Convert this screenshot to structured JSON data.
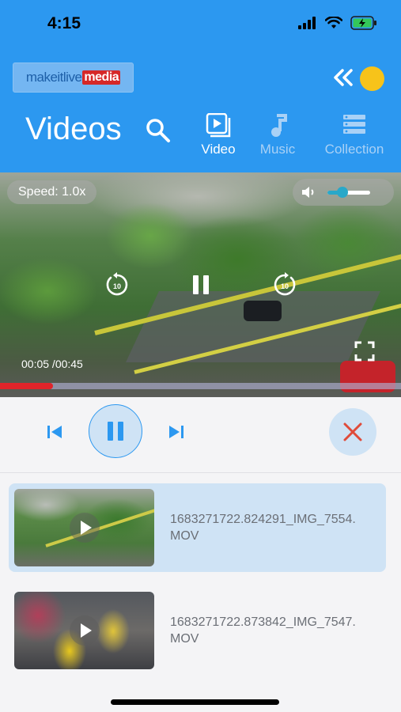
{
  "status_bar": {
    "time": "4:15"
  },
  "header": {
    "logo": {
      "part1": "makeitlive",
      "part2": "media"
    },
    "title": "Videos",
    "tabs": [
      {
        "label": "Video",
        "active": true,
        "icon": "video-play-icon"
      },
      {
        "label": "Music",
        "active": false,
        "icon": "music-note-icon"
      },
      {
        "label": "Collection",
        "active": false,
        "icon": "collection-stack-icon"
      }
    ],
    "accent_color": "#2c98f0",
    "avatar_color": "#f7c31a"
  },
  "video_player": {
    "speed_label": "Speed: 1.0x",
    "volume_level": 0.35,
    "time_display": "00:05 /00:45",
    "progress": 0.133,
    "seek_color": "#e0242a"
  },
  "playback_controls": {
    "prev_icon": "skip-previous-icon",
    "play_state_icon": "pause-icon",
    "next_icon": "skip-next-icon",
    "close_icon": "close-x-icon",
    "close_color": "#e04b3a"
  },
  "video_list": [
    {
      "title": "1683271722.824291_IMG_7554.MOV",
      "selected": true
    },
    {
      "title": "1683271722.873842_IMG_7547.MOV",
      "selected": false
    }
  ]
}
